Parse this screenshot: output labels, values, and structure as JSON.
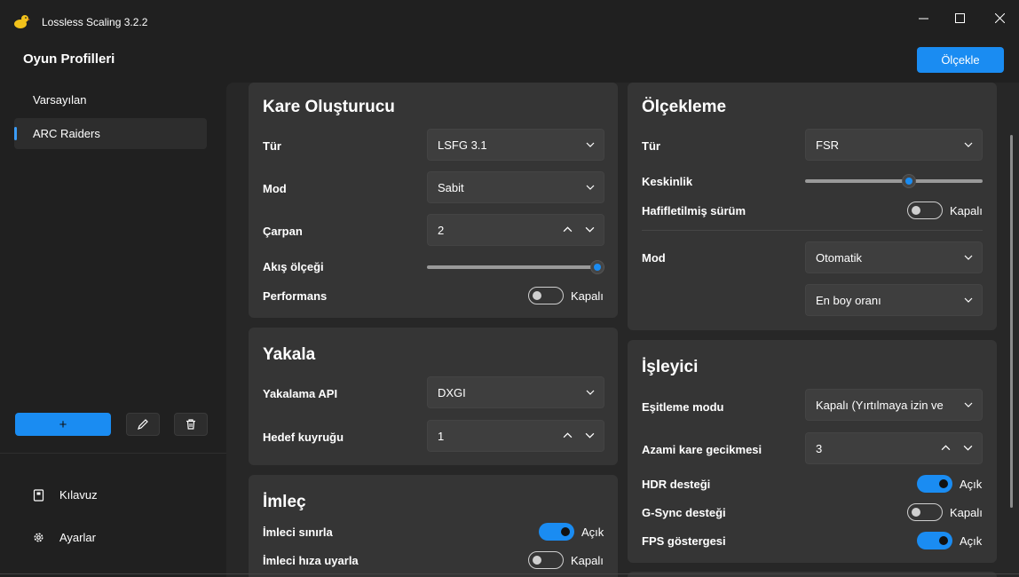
{
  "window": {
    "title": "Lossless Scaling 3.2.2"
  },
  "sidebar": {
    "title": "Oyun Profilleri",
    "profiles": [
      {
        "label": "Varsayılan",
        "active": false
      },
      {
        "label": "ARC Raiders",
        "active": true
      }
    ],
    "add_label": "+",
    "nav": [
      {
        "label": "Kılavuz",
        "icon": "book-icon"
      },
      {
        "label": "Ayarlar",
        "icon": "gear-icon"
      }
    ]
  },
  "scale_button": "Ölçekle",
  "frame_gen": {
    "title": "Kare Oluşturucu",
    "type_label": "Tür",
    "type_value": "LSFG 3.1",
    "mode_label": "Mod",
    "mode_value": "Sabit",
    "multiplier_label": "Çarpan",
    "multiplier_value": "2",
    "flow_label": "Akış ölçeği",
    "flow_value": 1.0,
    "perf_label": "Performans",
    "perf_state": "Kapalı"
  },
  "capture": {
    "title": "Yakala",
    "api_label": "Yakalama API",
    "api_value": "DXGI",
    "queue_label": "Hedef kuyruğu",
    "queue_value": "1"
  },
  "cursor": {
    "title": "İmleç",
    "clip_label": "İmleci sınırla",
    "clip_state": "Açık",
    "adjust_label": "İmleci hıza uyarla",
    "adjust_state": "Kapalı"
  },
  "scaling": {
    "title": "Ölçekleme",
    "type_label": "Tür",
    "type_value": "FSR",
    "sharpness_label": "Keskinlik",
    "sharpness_value": 0.59,
    "lite_label": "Hafifletilmiş sürüm",
    "lite_state": "Kapalı",
    "mode_label": "Mod",
    "mode_value": "Otomatik",
    "aspect_value": "En boy oranı"
  },
  "renderer": {
    "title": "İşleyici",
    "sync_label": "Eşitleme modu",
    "sync_value": "Kapalı (Yırtılmaya izin ve",
    "latency_label": "Azami kare gecikmesi",
    "latency_value": "3",
    "hdr_label": "HDR desteği",
    "hdr_state": "Açık",
    "gsync_label": "G-Sync desteği",
    "gsync_state": "Kapalı",
    "fps_label": "FPS göstergesi",
    "fps_state": "Açık"
  },
  "colors": {
    "accent": "#1a8cf2",
    "card": "#353535",
    "background": "#202020"
  }
}
